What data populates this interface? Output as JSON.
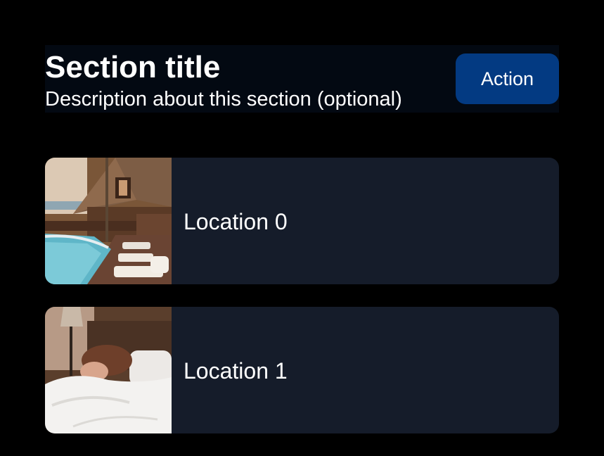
{
  "section": {
    "title": "Section title",
    "description": "Description about this section (optional)",
    "action_label": "Action"
  },
  "colors": {
    "background": "#000000",
    "header_bg": "#030912",
    "action_bg": "#033a82",
    "card_bg": "#151c2a",
    "text": "#ffffff"
  },
  "locations": [
    {
      "label": "Location 0",
      "image": "resort-pool-photo"
    },
    {
      "label": "Location 1",
      "image": "person-in-bed-photo"
    }
  ]
}
